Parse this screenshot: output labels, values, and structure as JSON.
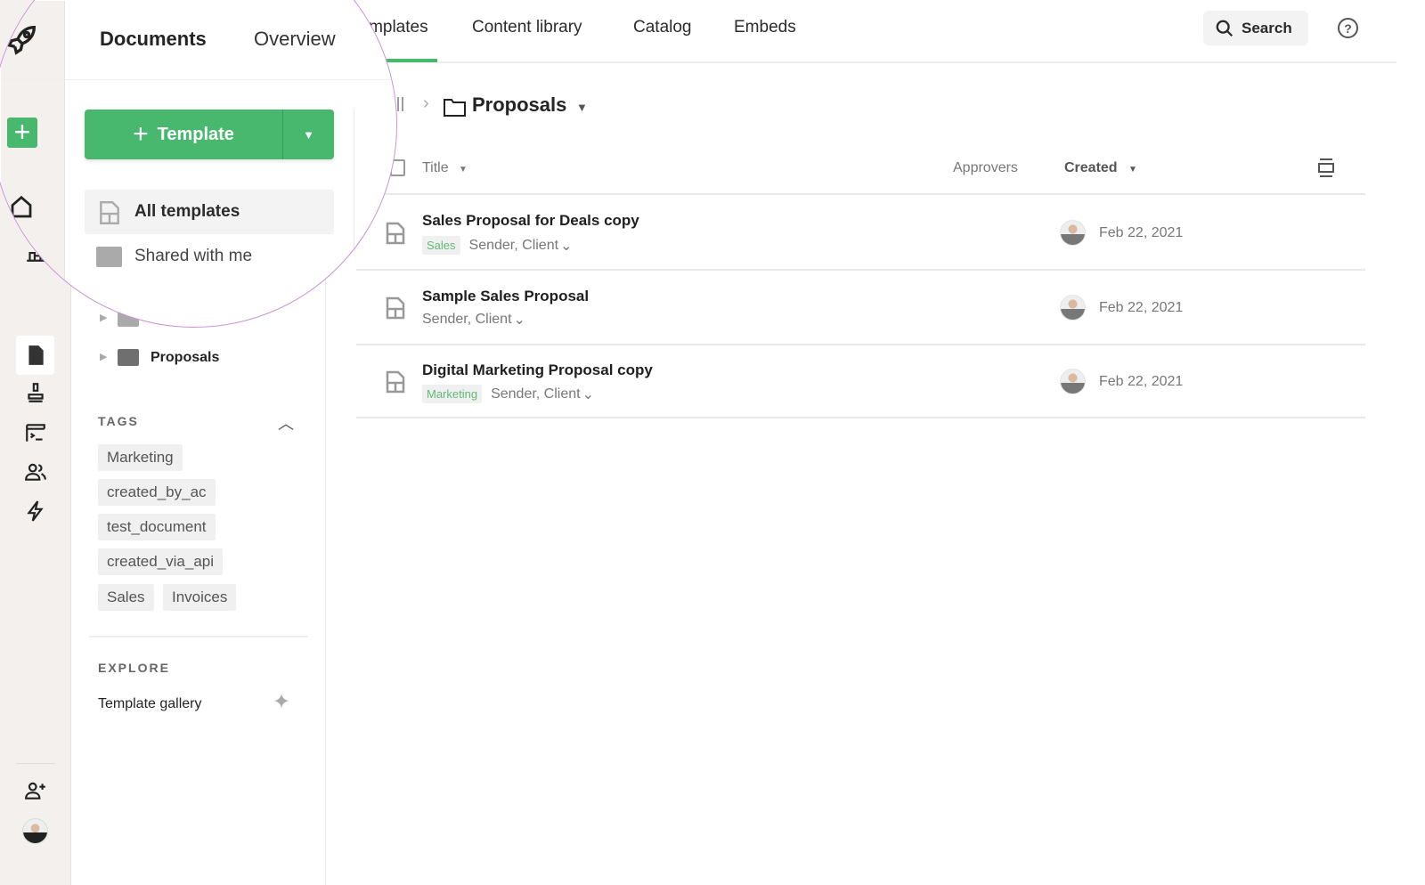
{
  "nav": {
    "tabs": [
      "Documents",
      "Overview",
      "Templates",
      "Content library",
      "Catalog",
      "Embeds"
    ],
    "active_tab": "Templates",
    "search_label": "Search",
    "help": "?"
  },
  "sidebar": {
    "new_button": "Template",
    "nav": [
      "All templates",
      "Shared with me"
    ],
    "folders": [
      "Proposals"
    ],
    "tags_title": "TAGS",
    "tags": [
      "Marketing",
      "created_by_ac",
      "test_document",
      "created_via_api",
      "Sales",
      "Invoices"
    ],
    "explore_title": "EXPLORE",
    "explore_items": [
      "Template gallery"
    ]
  },
  "breadcrumb": {
    "root": "All",
    "current": "Proposals"
  },
  "table": {
    "headers": {
      "title": "Title",
      "approvers": "Approvers",
      "created": "Created"
    },
    "rows": [
      {
        "title": "Sales Proposal for Deals copy",
        "tag": "Sales",
        "roles": "Sender, Client",
        "created": "Feb 22, 2021"
      },
      {
        "title": "Sample Sales Proposal",
        "tag": null,
        "roles": "Sender, Client",
        "created": "Feb 22, 2021"
      },
      {
        "title": "Digital Marketing Proposal copy",
        "tag": "Marketing",
        "roles": "Sender, Client",
        "created": "Feb 22, 2021"
      }
    ]
  },
  "colors": {
    "accent": "#47b86e",
    "magnifier_border": "#c994d4",
    "rail_bg": "#f3f0ed"
  }
}
